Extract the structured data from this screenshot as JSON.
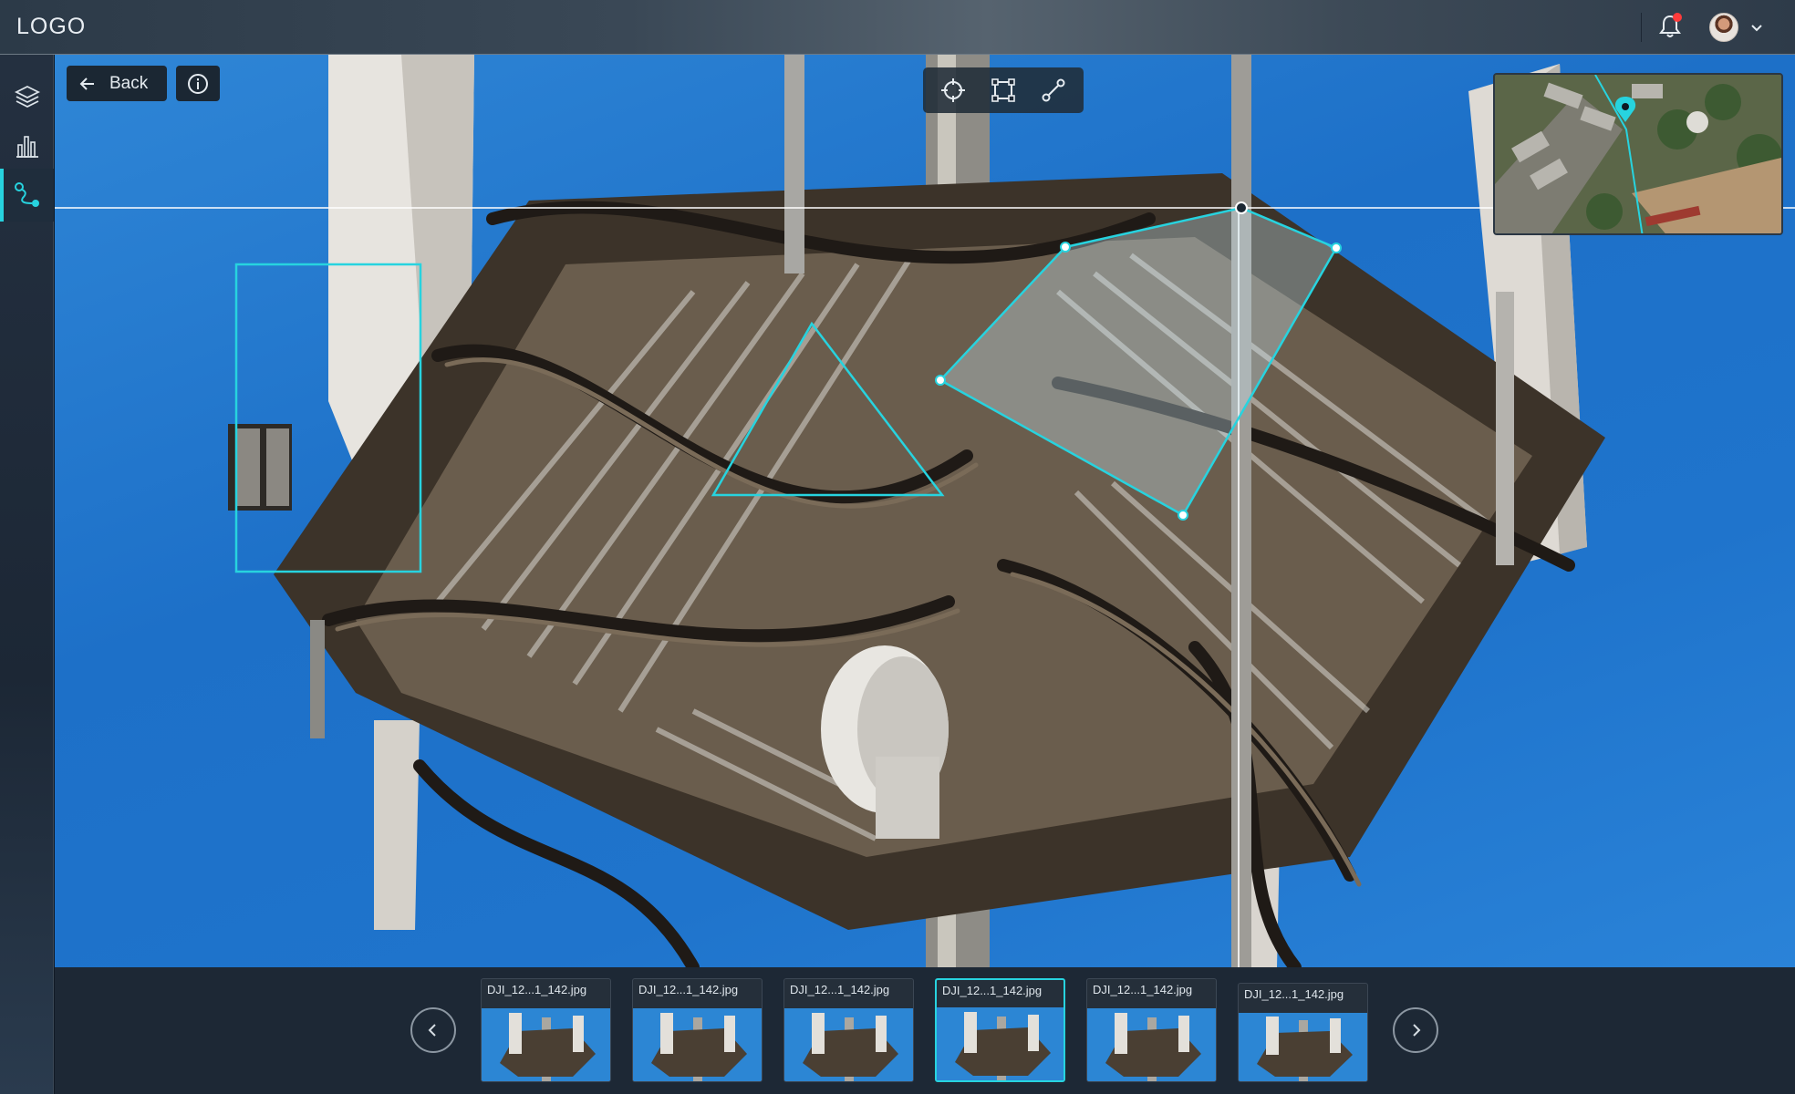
{
  "app": {
    "logo": "LOGO"
  },
  "header": {
    "notifications_icon": "bell-icon",
    "has_unread_notifications": true,
    "user_menu_icon": "chevron-down-icon"
  },
  "sidebar": {
    "items": [
      {
        "icon": "layers-icon",
        "active": false
      },
      {
        "icon": "bar-chart-icon",
        "active": false
      },
      {
        "icon": "route-icon",
        "active": true
      }
    ]
  },
  "viewer": {
    "back_label": "Back",
    "info_icon": "info-icon",
    "tools": [
      {
        "icon": "crosshair-icon"
      },
      {
        "icon": "bounding-box-icon"
      },
      {
        "icon": "line-measure-icon"
      }
    ],
    "annotation_color": "#27d3df"
  },
  "filmstrip": {
    "prev_icon": "chevron-left-icon",
    "next_icon": "chevron-right-icon",
    "thumbnails": [
      {
        "label": "DJI_12...1_142.jpg",
        "selected": false
      },
      {
        "label": "DJI_12...1_142.jpg",
        "selected": false
      },
      {
        "label": "DJI_12...1_142.jpg",
        "selected": false
      },
      {
        "label": "DJI_12...1_142.jpg",
        "selected": true
      },
      {
        "label": "DJI_12...1_142.jpg",
        "selected": false
      },
      {
        "label": "DJI_12...1_142.jpg",
        "selected": false
      }
    ]
  }
}
